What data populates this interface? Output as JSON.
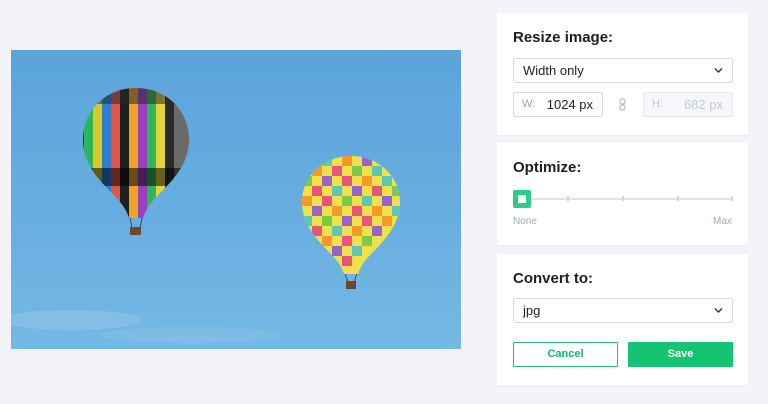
{
  "preview": {
    "description_icon": "photo-preview"
  },
  "resize": {
    "title": "Resize image:",
    "mode_selected": "Width only",
    "width_label": "W:",
    "width_value": "1024 px",
    "height_label": "H:",
    "height_value": "682 px",
    "link_icon": "link-icon"
  },
  "optimize": {
    "title": "Optimize:",
    "level": 0,
    "min_label": "None",
    "max_label": "Max"
  },
  "convert": {
    "title": "Convert to:",
    "format_selected": "jpg",
    "cancel_label": "Cancel",
    "save_label": "Save"
  },
  "colors": {
    "accent": "#14c473",
    "background": "#f2f4f9",
    "sky": "#64acdf"
  }
}
